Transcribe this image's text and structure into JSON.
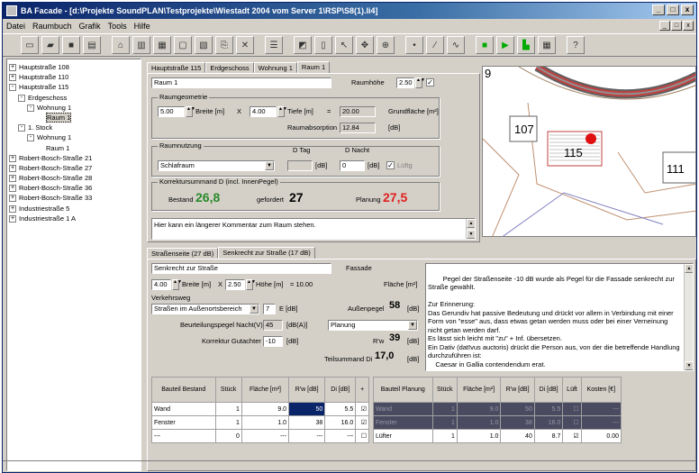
{
  "window": {
    "title": "BA Facade - [d:\\Projekte SoundPLAN\\Testprojekte\\Wiestadt 2004 vom Server 1\\RSP\\S8(1).li4]",
    "min": "_",
    "max": "□",
    "close": "x"
  },
  "menu": [
    "Datei",
    "Raumbuch",
    "Grafik",
    "Tools",
    "Hilfe"
  ],
  "tree": [
    {
      "label": "Hauptstraße 108",
      "indent": 0,
      "pm": "+"
    },
    {
      "label": "Hauptstraße 110",
      "indent": 0,
      "pm": "+"
    },
    {
      "label": "Hauptstraße 115",
      "indent": 0,
      "pm": "-"
    },
    {
      "label": "Erdgeschoss",
      "indent": 1,
      "pm": "-"
    },
    {
      "label": "Wohnung 1",
      "indent": 2,
      "pm": "-"
    },
    {
      "label": "Raum 1",
      "indent": 3,
      "pm": ""
    },
    {
      "label": "1. Stock",
      "indent": 1,
      "pm": "-"
    },
    {
      "label": "Wohnung 1",
      "indent": 2,
      "pm": "-"
    },
    {
      "label": "Raum 1",
      "indent": 3,
      "pm": ""
    },
    {
      "label": "Robert-Bosch-Straße 21",
      "indent": 0,
      "pm": "+"
    },
    {
      "label": "Robert-Bosch-Straße 27",
      "indent": 0,
      "pm": "+"
    },
    {
      "label": "Robert-Bosch-Straße 28",
      "indent": 0,
      "pm": "+"
    },
    {
      "label": "Robert-Bosch-Straße 36",
      "indent": 0,
      "pm": "+"
    },
    {
      "label": "Robert-Bosch-Straße 33",
      "indent": 0,
      "pm": "+"
    },
    {
      "label": "Industriestraße 5",
      "indent": 0,
      "pm": "+"
    },
    {
      "label": "Industriestraße 1 A",
      "indent": 0,
      "pm": "+"
    }
  ],
  "top_tabs": [
    "Hauptstraße 115",
    "Erdgeschoss",
    "Wohnung 1",
    "Raum 1"
  ],
  "room": {
    "name": "Raum 1",
    "raumhoehe_label": "Raumhöhe",
    "raumhoehe": "2.50",
    "geometrie_title": "Raumgeometrie",
    "breite": "5.00",
    "breite_label": "Breite [m]",
    "x": "X",
    "tiefe": "4.00",
    "tiefe_label": "Tiefe [m]",
    "eq": "=",
    "grundflaeche": "20.00",
    "grundflaeche_label": "Grundfläche [m²]",
    "absorption_label": "Raumabsorption",
    "absorption": "12.84",
    "absorption_unit": "[dB]",
    "nutzung_title": "Raumnutzung",
    "dtag_label": "D Tag",
    "dnacht_label": "D Nacht",
    "nutzung": "Schlafraum",
    "dtag": "",
    "dtag_unit": "[dB]",
    "dnacht": "0",
    "dnacht_unit": "[dB]",
    "lueftung": "Lüftg",
    "korrektur_title": "Korrektursummand D (incl. InnenPegel)",
    "bestand_label": "Bestand",
    "bestand": "26,8",
    "gefordert_label": "gefordert",
    "gefordert": "27",
    "planung_label": "Planung",
    "planung": "27,5",
    "comment": "Hier kann ein längerer Kommentar zum Raum stehen."
  },
  "map": {
    "labels": [
      "107",
      "115",
      "111",
      "9"
    ]
  },
  "bottom_tabs": [
    "Straßenseite (27 dB)",
    "Senkrecht zur Straße (17 dB)"
  ],
  "facade": {
    "name": "Senkrecht zur Straße",
    "facade_label": "Fassade",
    "breite": "4.00",
    "breite_label": "Breite [m]",
    "x": "X",
    "hoehe": "2.50",
    "hoehe_label": "Höhe [m]",
    "flaeche": "= 10.00",
    "flaeche_label": "Fläche [m²]",
    "verkehrsweg_label": "Verkehrsweg",
    "verkehrsweg": "Straßen im Außenortsbereich",
    "e_val": "7",
    "e_label": "E [dB]",
    "aussenpegel_label": "Außenpegel",
    "aussenpegel": "58",
    "aussenpegel_unit": "[dB]",
    "beurteilung_label": "Beurteilungspegel Nacht(V)",
    "beurteilung": "45",
    "beurteilung_unit": "[dB(A)]",
    "planung_combo": "Planung",
    "korrektur_label": "Korrektur Gutachter",
    "korrektur": "-10",
    "korrektur_unit": "[dB]",
    "rw_label": "R'w",
    "rw": "39",
    "rw_unit": "[dB]",
    "teilsummand_label": "Teilsummand Di",
    "teilsummand": "17,0",
    "teilsummand_unit": "[dB]",
    "notes": "Pegel der Straßenseite -10 dB wurde als Pegel für die Fassade senkrecht zur Straße gewählt.\n\nZur Erinnerung:\nDas Gerundiv hat passive Bedeutung und drückt vor allem in Verbindung mit einer Form von \"esse\" aus, dass etwas getan werden muss oder bei einer Verneinung nicht getan werden darf.\nEs lässt sich leicht mit \"zu\" + Inf. übersetzen.\nEin Dativ (datīvus auctoris) drückt die Person aus, von der die betreffende Handlung durchzuführen ist:\n    Caesar in Gallia contendendum erat."
  },
  "table_bestand": {
    "headers": [
      "Bauteil Bestand",
      "Stück",
      "Fläche [m²]",
      "R'w [dB]",
      "Di [dB]",
      "+"
    ],
    "rows": [
      [
        "Wand",
        "1",
        "9.0",
        "50",
        "5.5",
        "☑"
      ],
      [
        "Fenster",
        "1",
        "1.0",
        "38",
        "16.0",
        "☑"
      ],
      [
        "---",
        "0",
        "---",
        "---",
        "---",
        "☐"
      ]
    ]
  },
  "table_planung": {
    "headers": [
      "Bauteil Planung",
      "Stück",
      "Fläche [m²]",
      "R'w [dB]",
      "Di [dB]",
      "Lüft",
      "Kosten [€]"
    ],
    "rows": [
      [
        "Wand",
        "1",
        "9.0",
        "50",
        "5.5",
        "☐",
        "---"
      ],
      [
        "Fenster",
        "1",
        "1.0",
        "38",
        "16.0",
        "☐",
        "---"
      ],
      [
        "Lüfter",
        "1",
        "1.0",
        "40",
        "8.7",
        "☑",
        "0.00"
      ]
    ]
  },
  "colors": {
    "bestand": "#2a8a2a",
    "planung": "#e02020",
    "title": "#0a246a"
  }
}
